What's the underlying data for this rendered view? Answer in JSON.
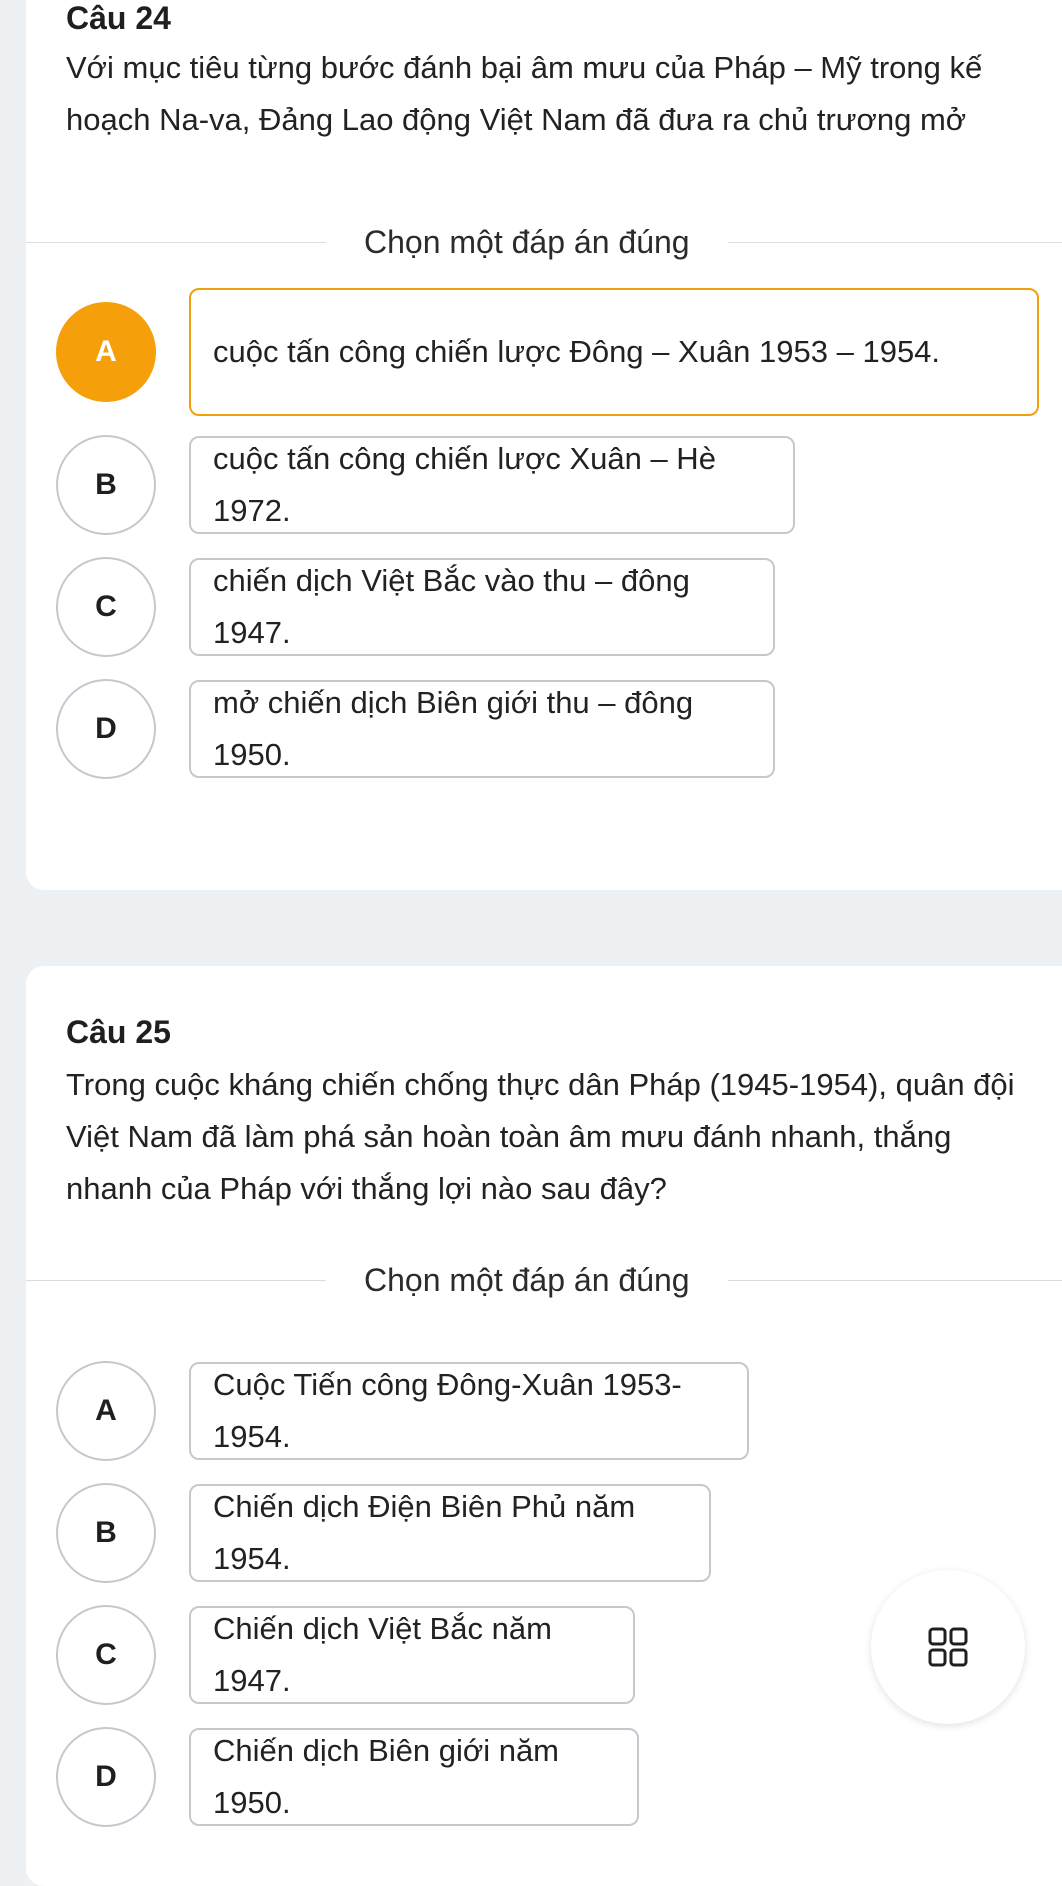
{
  "questions": [
    {
      "number": "Câu 24",
      "text": "Với mục tiêu từng bước đánh bại âm mưu của Pháp – Mỹ trong kế hoạch Na-va, Đảng Lao động Việt Nam đã đưa ra chủ trương mở",
      "prompt": "Chọn một đáp án đúng",
      "selected": "A",
      "options": [
        {
          "letter": "A",
          "text": "cuộc tấn công chiến lược Đông – Xuân 1953 – 1954."
        },
        {
          "letter": "B",
          "text": "cuộc tấn công chiến lược Xuân – Hè 1972."
        },
        {
          "letter": "C",
          "text": "chiến dịch Việt Bắc vào thu – đông 1947."
        },
        {
          "letter": "D",
          "text": "mở chiến dịch Biên giới thu – đông 1950."
        }
      ]
    },
    {
      "number": "Câu 25",
      "text": "Trong cuộc kháng chiến chống thực dân Pháp (1945-1954), quân đội Việt Nam đã làm phá sản hoàn toàn âm mưu đánh nhanh, thắng nhanh của Pháp với thắng lợi nào sau đây?",
      "prompt": "Chọn một đáp án đúng",
      "options": [
        {
          "letter": "A",
          "text": "Cuộc Tiến công Đông-Xuân 1953-1954."
        },
        {
          "letter": "B",
          "text": "Chiến dịch Điện Biên Phủ năm 1954."
        },
        {
          "letter": "C",
          "text": "Chiến dịch Việt Bắc năm 1947."
        },
        {
          "letter": "D",
          "text": "Chiến dịch Biên giới năm 1950."
        }
      ]
    }
  ],
  "fab": {
    "icon": "grid-icon"
  },
  "colors": {
    "accent": "#f5a00b",
    "border": "#c4c9cf",
    "background": "#eef1f4",
    "card": "#ffffff"
  }
}
